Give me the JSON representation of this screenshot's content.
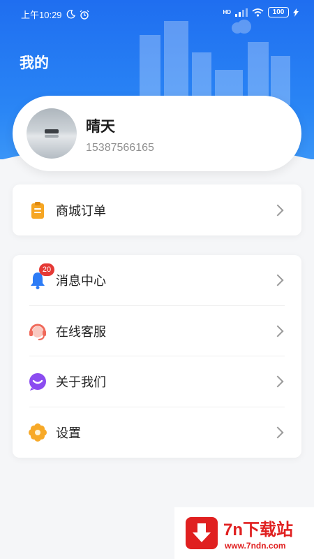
{
  "status_bar": {
    "time": "上午10:29",
    "network": "HD",
    "battery": "100",
    "text_color": "#ffffff"
  },
  "header": {
    "title": "我的",
    "gradient_colors": [
      "#1f6ef0",
      "#3a95f7"
    ]
  },
  "profile": {
    "name": "晴天",
    "phone": "15387566165"
  },
  "menu_group_1": [
    {
      "label": "商城订单",
      "icon": "clipboard-icon"
    }
  ],
  "menu_group_2": [
    {
      "label": "消息中心",
      "icon": "bell-icon",
      "badge": "20"
    },
    {
      "label": "在线客服",
      "icon": "headset-icon"
    },
    {
      "label": "关于我们",
      "icon": "chat-bubble-icon"
    },
    {
      "label": "设置",
      "icon": "flower-gear-icon"
    }
  ],
  "colors": {
    "accent": "#1f6ef0",
    "badge": "#e53935",
    "order_icon": "#f6a623",
    "bell_icon": "#2d7cf6",
    "service_icon": "#f06a5b",
    "about_icon": "#8b4cf0",
    "settings_icon": "#f7a928"
  },
  "watermark": {
    "title": "7n下载站",
    "url": "www.7ndn.com"
  }
}
